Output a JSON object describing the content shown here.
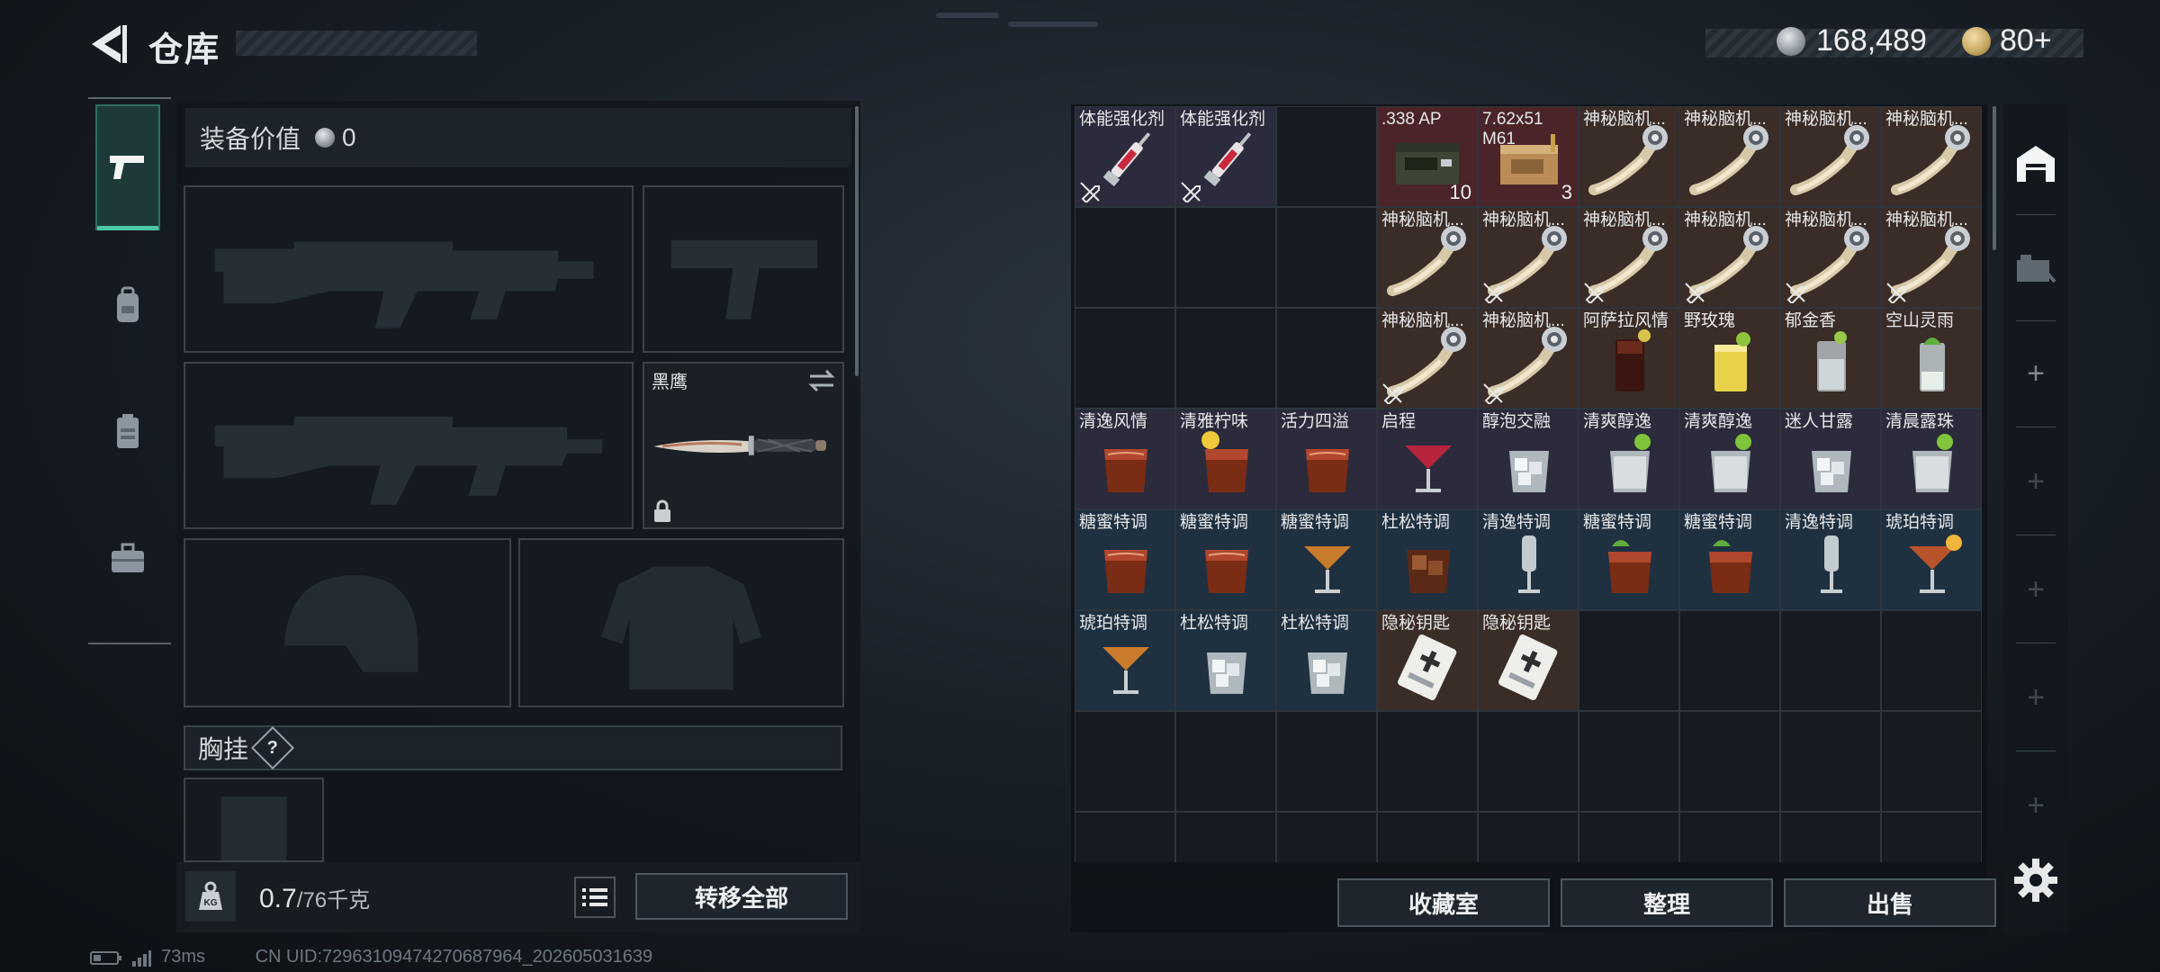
{
  "header": {
    "title": "仓库",
    "currency1": "168,489",
    "currency2": "80+"
  },
  "equip": {
    "value_label": "装备价值",
    "value": "0",
    "knife_name": "黑鹰",
    "chest_label": "胸挂",
    "chest_help": "?",
    "weight_current": "0.7",
    "weight_max": "/76千克",
    "weight_icon_text": "KG",
    "transfer_all": "转移全部"
  },
  "status": {
    "ping": "73ms",
    "uid": "CN UID:72963109474270687964_202605031639"
  },
  "inventory": {
    "items": [
      {
        "r": 0,
        "c": 0,
        "name": "体能强化剂",
        "icon": "syringe",
        "color": "purple",
        "nt": true
      },
      {
        "r": 0,
        "c": 1,
        "name": "体能强化剂",
        "icon": "syringe",
        "color": "purple",
        "nt": true
      },
      {
        "r": 0,
        "c": 3,
        "name": ".338 AP",
        "icon": "ammo-box-green",
        "color": "red",
        "qty": "10",
        "wrap": true
      },
      {
        "r": 0,
        "c": 4,
        "name": "7.62x51 M61",
        "icon": "ammo-box-tan",
        "color": "red",
        "qty": "3",
        "wrap": true
      },
      {
        "r": 0,
        "c": 5,
        "name": "神秘脑机...",
        "icon": "brain-chip",
        "color": "brown"
      },
      {
        "r": 0,
        "c": 6,
        "name": "神秘脑机...",
        "icon": "brain-chip",
        "color": "brown"
      },
      {
        "r": 0,
        "c": 7,
        "name": "神秘脑机...",
        "icon": "brain-chip",
        "color": "brown"
      },
      {
        "r": 0,
        "c": 8,
        "name": "神秘脑机...",
        "icon": "brain-chip",
        "color": "brown"
      },
      {
        "r": 1,
        "c": 3,
        "name": "神秘脑机...",
        "icon": "brain-chip",
        "color": "brown"
      },
      {
        "r": 1,
        "c": 4,
        "name": "神秘脑机...",
        "icon": "brain-chip",
        "color": "brown",
        "nt": true
      },
      {
        "r": 1,
        "c": 5,
        "name": "神秘脑机...",
        "icon": "brain-chip",
        "color": "brown",
        "nt": true
      },
      {
        "r": 1,
        "c": 6,
        "name": "神秘脑机...",
        "icon": "brain-chip",
        "color": "brown",
        "nt": true
      },
      {
        "r": 1,
        "c": 7,
        "name": "神秘脑机...",
        "icon": "brain-chip",
        "color": "brown",
        "nt": true
      },
      {
        "r": 1,
        "c": 8,
        "name": "神秘脑机...",
        "icon": "brain-chip",
        "color": "brown",
        "nt": true
      },
      {
        "r": 2,
        "c": 3,
        "name": "神秘脑机...",
        "icon": "brain-chip",
        "color": "brown",
        "nt": true
      },
      {
        "r": 2,
        "c": 4,
        "name": "神秘脑机...",
        "icon": "brain-chip",
        "color": "brown",
        "nt": true
      },
      {
        "r": 2,
        "c": 5,
        "name": "阿萨拉风情",
        "icon": "tall-cola",
        "color": "brown"
      },
      {
        "r": 2,
        "c": 6,
        "name": "野玫瑰",
        "icon": "tall-yellow",
        "color": "brown"
      },
      {
        "r": 2,
        "c": 7,
        "name": "郁金香",
        "icon": "tall-clear",
        "color": "brown"
      },
      {
        "r": 2,
        "c": 8,
        "name": "空山灵雨",
        "icon": "tall-mojito",
        "color": "brown"
      },
      {
        "r": 3,
        "c": 0,
        "name": "清逸风情",
        "icon": "rocks-amber",
        "color": "purple"
      },
      {
        "r": 3,
        "c": 1,
        "name": "清雅柠味",
        "icon": "rocks-lemon",
        "color": "purple"
      },
      {
        "r": 3,
        "c": 2,
        "name": "活力四溢",
        "icon": "rocks-amber",
        "color": "purple"
      },
      {
        "r": 3,
        "c": 3,
        "name": "启程",
        "icon": "martini-red",
        "color": "purple"
      },
      {
        "r": 3,
        "c": 4,
        "name": "醇泡交融",
        "icon": "rocks-ice",
        "color": "purple"
      },
      {
        "r": 3,
        "c": 5,
        "name": "清爽醇逸",
        "icon": "rocks-lime",
        "color": "purple"
      },
      {
        "r": 3,
        "c": 6,
        "name": "清爽醇逸",
        "icon": "rocks-lime",
        "color": "purple"
      },
      {
        "r": 3,
        "c": 7,
        "name": "迷人甘露",
        "icon": "rocks-ice",
        "color": "purple"
      },
      {
        "r": 3,
        "c": 8,
        "name": "清晨露珠",
        "icon": "rocks-lime",
        "color": "purple"
      },
      {
        "r": 4,
        "c": 0,
        "name": "糖蜜特调",
        "icon": "rocks-amber",
        "color": "blue"
      },
      {
        "r": 4,
        "c": 1,
        "name": "糖蜜特调",
        "icon": "rocks-amber",
        "color": "blue"
      },
      {
        "r": 4,
        "c": 2,
        "name": "糖蜜特调",
        "icon": "martini-amber",
        "color": "blue"
      },
      {
        "r": 4,
        "c": 3,
        "name": "杜松特调",
        "icon": "rocks-whisky",
        "color": "blue"
      },
      {
        "r": 4,
        "c": 4,
        "name": "清逸特调",
        "icon": "flute",
        "color": "blue"
      },
      {
        "r": 4,
        "c": 5,
        "name": "糖蜜特调",
        "icon": "rocks-mint",
        "color": "blue"
      },
      {
        "r": 4,
        "c": 6,
        "name": "糖蜜特调",
        "icon": "rocks-mint",
        "color": "blue"
      },
      {
        "r": 4,
        "c": 7,
        "name": "清逸特调",
        "icon": "flute",
        "color": "blue"
      },
      {
        "r": 4,
        "c": 8,
        "name": "琥珀特调",
        "icon": "martini-orange",
        "color": "blue"
      },
      {
        "r": 5,
        "c": 0,
        "name": "琥珀特调",
        "icon": "martini-amber",
        "color": "blue"
      },
      {
        "r": 5,
        "c": 1,
        "name": "杜松特调",
        "icon": "rocks-ice",
        "color": "blue"
      },
      {
        "r": 5,
        "c": 2,
        "name": "杜松特调",
        "icon": "rocks-ice",
        "color": "blue"
      },
      {
        "r": 5,
        "c": 3,
        "name": "隐秘钥匙",
        "icon": "keycard",
        "color": "brown"
      },
      {
        "r": 5,
        "c": 4,
        "name": "隐秘钥匙",
        "icon": "keycard",
        "color": "brown"
      }
    ],
    "buttons": {
      "collection": "收藏室",
      "sort": "整理",
      "sell": "出售"
    }
  }
}
